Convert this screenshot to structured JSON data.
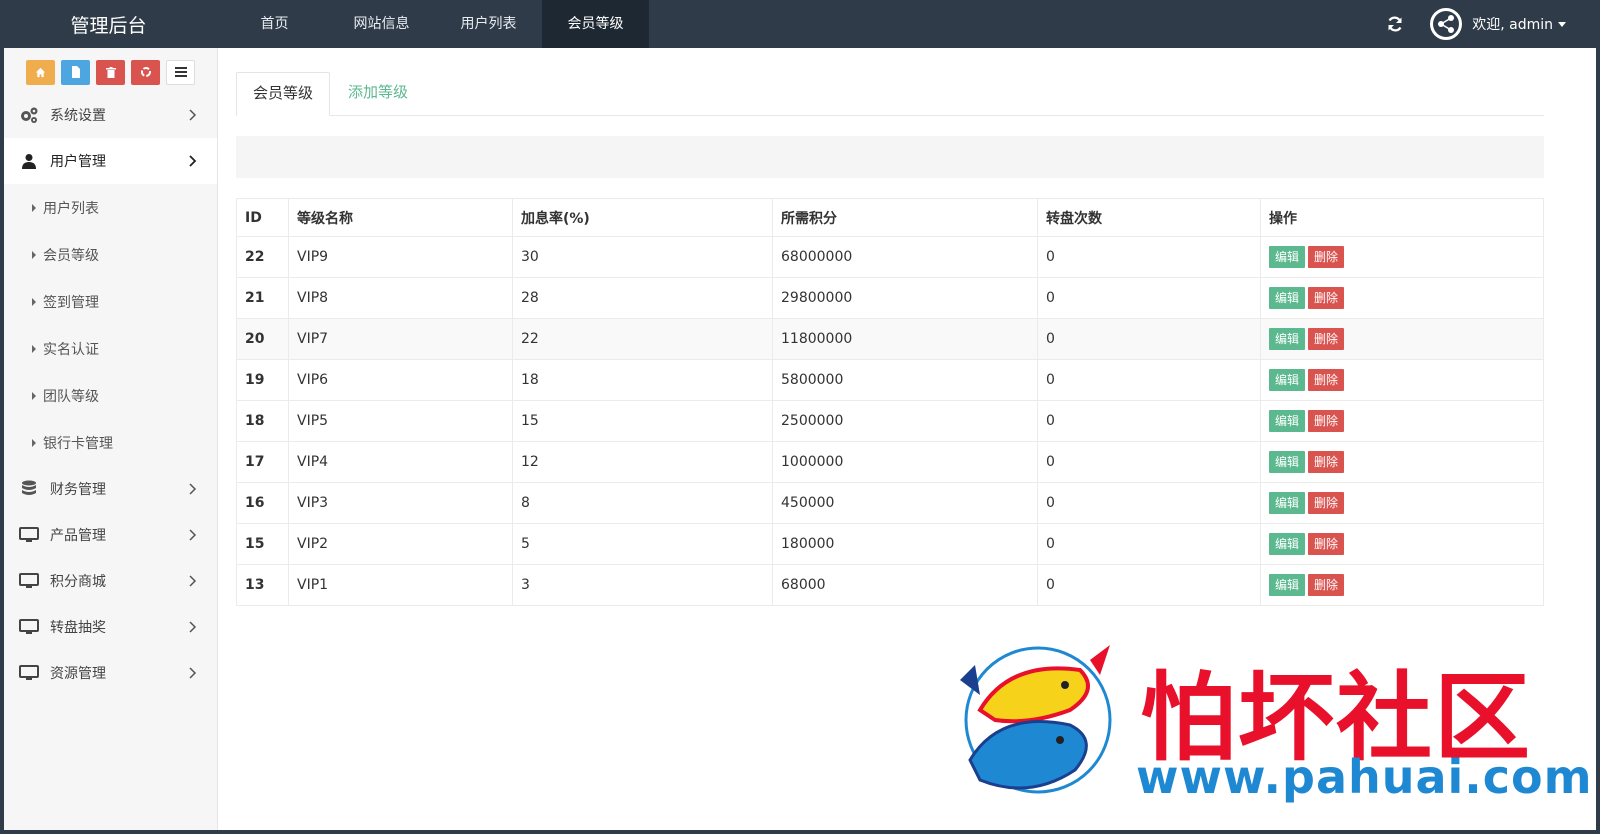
{
  "app": {
    "title": "管理后台"
  },
  "topnav": [
    {
      "label": "首页"
    },
    {
      "label": "网站信息"
    },
    {
      "label": "用户列表"
    },
    {
      "label": "会员等级"
    }
  ],
  "user": {
    "welcome": "欢迎, admin"
  },
  "sidebar": {
    "menus_top": [
      {
        "label": "系统设置",
        "icon": "gears-icon"
      },
      {
        "label": "用户管理",
        "icon": "user-icon"
      }
    ],
    "submenu": [
      {
        "label": "用户列表"
      },
      {
        "label": "会员等级"
      },
      {
        "label": "签到管理"
      },
      {
        "label": "实名认证"
      },
      {
        "label": "团队等级"
      },
      {
        "label": "银行卡管理"
      }
    ],
    "menus_bottom": [
      {
        "label": "财务管理",
        "icon": "database-icon"
      },
      {
        "label": "产品管理",
        "icon": "desktop-icon"
      },
      {
        "label": "积分商城",
        "icon": "desktop-icon"
      },
      {
        "label": "转盘抽奖",
        "icon": "desktop-icon"
      },
      {
        "label": "资源管理",
        "icon": "desktop-icon"
      }
    ]
  },
  "tabs": [
    {
      "label": "会员等级"
    },
    {
      "label": "添加等级"
    }
  ],
  "table": {
    "headers": [
      "ID",
      "等级名称",
      "加息率(%)",
      "所需积分",
      "转盘次数",
      "操作"
    ],
    "edit_label": "编辑",
    "delete_label": "删除",
    "rows": [
      {
        "id": "22",
        "name": "VIP9",
        "rate": "30",
        "points": "68000000",
        "spins": "0"
      },
      {
        "id": "21",
        "name": "VIP8",
        "rate": "28",
        "points": "29800000",
        "spins": "0"
      },
      {
        "id": "20",
        "name": "VIP7",
        "rate": "22",
        "points": "11800000",
        "spins": "0"
      },
      {
        "id": "19",
        "name": "VIP6",
        "rate": "18",
        "points": "5800000",
        "spins": "0"
      },
      {
        "id": "18",
        "name": "VIP5",
        "rate": "15",
        "points": "2500000",
        "spins": "0"
      },
      {
        "id": "17",
        "name": "VIP4",
        "rate": "12",
        "points": "1000000",
        "spins": "0"
      },
      {
        "id": "16",
        "name": "VIP3",
        "rate": "8",
        "points": "450000",
        "spins": "0"
      },
      {
        "id": "15",
        "name": "VIP2",
        "rate": "5",
        "points": "180000",
        "spins": "0"
      },
      {
        "id": "13",
        "name": "VIP1",
        "rate": "3",
        "points": "68000",
        "spins": "0"
      }
    ]
  },
  "watermark": {
    "title": "怕坏社区",
    "url": "www.pahuai.com"
  },
  "colors": {
    "topbar": "#2f3b48",
    "accent_green": "#5cb88f",
    "danger_red": "#d9534f"
  }
}
